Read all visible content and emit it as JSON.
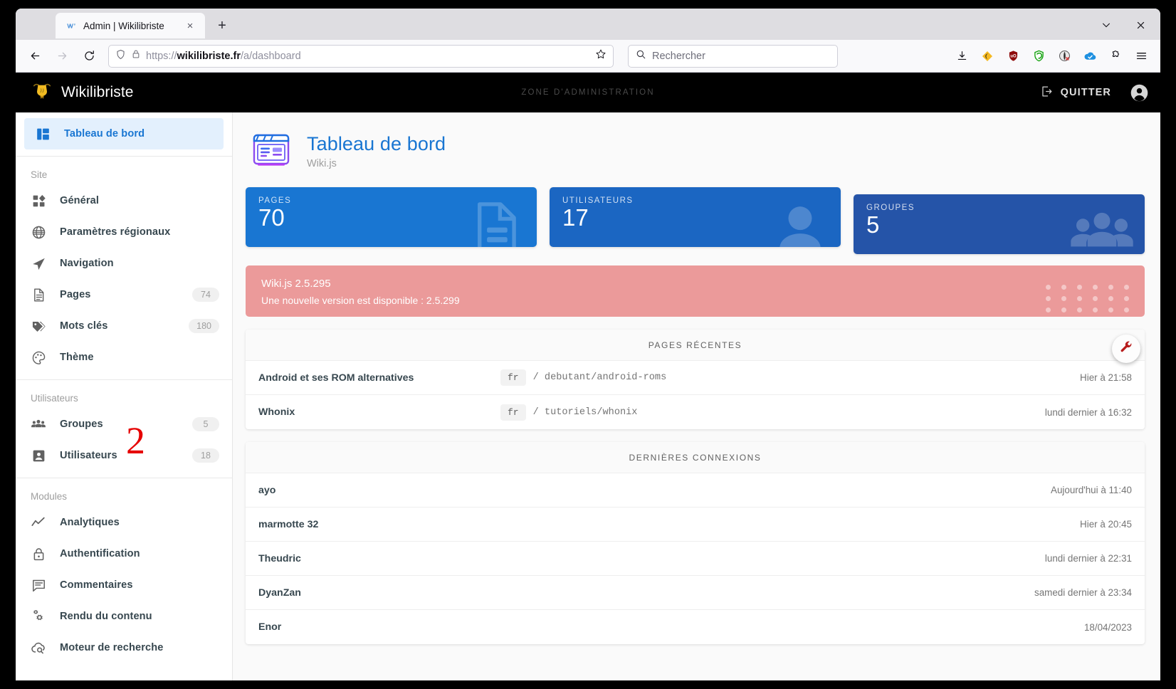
{
  "browser": {
    "tab": {
      "title": "Admin | Wikilibriste",
      "favicon": "wikijs-favicon",
      "close": "×"
    },
    "new_tab_label": "+",
    "window_controls": {
      "minimize": "⌄",
      "close": "✕"
    },
    "nav": {
      "back": "←",
      "forward": "→",
      "reload": "↻"
    },
    "url": {
      "scheme": "https://",
      "host": "wikilibriste.fr",
      "path": "/a/dashboard",
      "full": "https://wikilibriste.fr/a/dashboard"
    },
    "search": {
      "placeholder": "Rechercher"
    },
    "extensions": [
      "downloads-icon",
      "keepa-icon",
      "ublock-origin-icon",
      "privacy-badger-icon",
      "no-script-icon",
      "onedrive-icon",
      "extensions-puzzle-icon",
      "hamburger-menu-icon"
    ]
  },
  "appbar": {
    "brand": "Wikilibriste",
    "zone": "ZONE D'ADMINISTRATION",
    "quit_label": "QUITTER"
  },
  "sidebar": {
    "dashboard": {
      "label": "Tableau de bord",
      "icon": "dashboard-icon"
    },
    "sections": [
      {
        "title": "Site",
        "items": [
          {
            "label": "Général",
            "icon": "shapes-icon",
            "badge": ""
          },
          {
            "label": "Paramètres régionaux",
            "icon": "globe-icon",
            "badge": ""
          },
          {
            "label": "Navigation",
            "icon": "navigation-arrow-icon",
            "badge": ""
          },
          {
            "label": "Pages",
            "icon": "file-document-icon",
            "badge": "74"
          },
          {
            "label": "Mots clés",
            "icon": "tag-icon",
            "badge": "180"
          },
          {
            "label": "Thème",
            "icon": "palette-icon",
            "badge": ""
          }
        ]
      },
      {
        "title": "Utilisateurs",
        "items": [
          {
            "label": "Groupes",
            "icon": "group-users-icon",
            "badge": "5"
          },
          {
            "label": "Utilisateurs",
            "icon": "account-box-icon",
            "badge": "18"
          }
        ]
      },
      {
        "title": "Modules",
        "items": [
          {
            "label": "Analytiques",
            "icon": "chart-line-icon",
            "badge": ""
          },
          {
            "label": "Authentification",
            "icon": "lock-icon",
            "badge": ""
          },
          {
            "label": "Commentaires",
            "icon": "comment-icon",
            "badge": ""
          },
          {
            "label": "Rendu du contenu",
            "icon": "cogs-icon",
            "badge": ""
          },
          {
            "label": "Moteur de recherche",
            "icon": "cloud-search-icon",
            "badge": ""
          }
        ]
      }
    ],
    "annotation": "2"
  },
  "page": {
    "title": "Tableau de bord",
    "subtitle": "Wiki.js",
    "icon": "dashboard-illustration-icon"
  },
  "stats": [
    {
      "label": "PAGES",
      "value": "70",
      "color": "#1976d2",
      "deco": "file-document-icon"
    },
    {
      "label": "UTILISATEURS",
      "value": "17",
      "color": "#1b66c2",
      "deco": "account-icon"
    },
    {
      "label": "GROUPES",
      "value": "5",
      "color": "#2554a8",
      "deco": "group-users-icon"
    }
  ],
  "alert": {
    "title": "Wiki.js 2.5.295",
    "message": "Une nouvelle version est disponible : 2.5.299",
    "color": "#eb9a9a"
  },
  "fab": {
    "icon": "wrench-icon",
    "color": "#b71c1c"
  },
  "recent_pages": {
    "heading": "PAGES RÉCENTES",
    "rows": [
      {
        "title": "Android et ses ROM alternatives",
        "locale": "fr",
        "path": "/ debutant/android-roms",
        "time": "Hier à 21:58"
      },
      {
        "title": "Whonix",
        "locale": "fr",
        "path": "/ tutoriels/whonix",
        "time": "lundi dernier à 16:32"
      }
    ]
  },
  "recent_logins": {
    "heading": "DERNIÈRES CONNEXIONS",
    "rows": [
      {
        "name": "ayo",
        "time": "Aujourd'hui à 11:40"
      },
      {
        "name": "marmotte 32",
        "time": "Hier à 20:45"
      },
      {
        "name": "Theudric",
        "time": "lundi dernier à 22:31"
      },
      {
        "name": "DyanZan",
        "time": "samedi dernier à 23:34"
      },
      {
        "name": "Enor",
        "time": "18/04/2023"
      }
    ]
  }
}
